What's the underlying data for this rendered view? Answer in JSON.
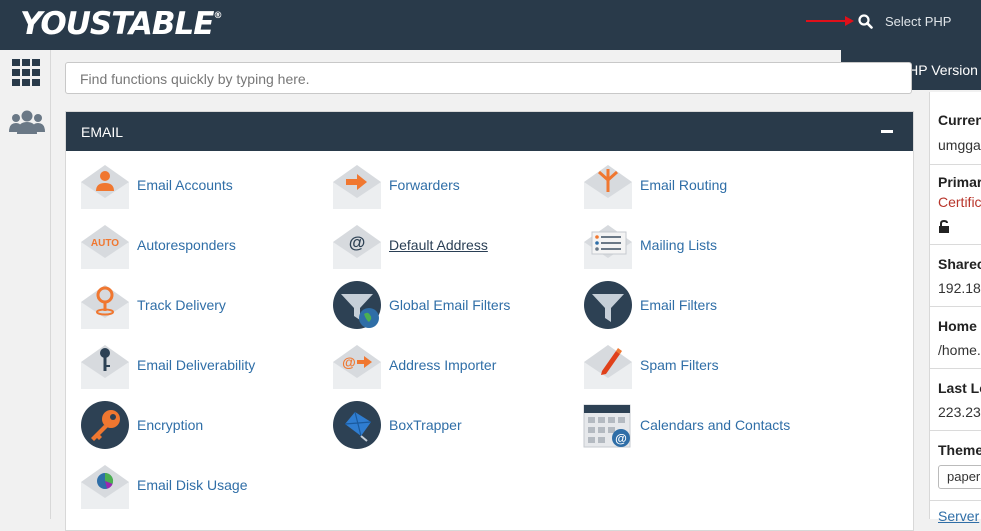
{
  "brand": {
    "name": "YOUSTABLE",
    "mark": "®"
  },
  "header": {
    "search_label": "Select PHP"
  },
  "dropdown": {
    "item": "Select PHP Version"
  },
  "search": {
    "placeholder": "Find functions quickly by typing here."
  },
  "email_panel": {
    "title": "EMAIL",
    "items": [
      {
        "label": "Email Accounts",
        "icon": "email-accounts-icon"
      },
      {
        "label": "Forwarders",
        "icon": "forwarders-icon"
      },
      {
        "label": "Email Routing",
        "icon": "email-routing-icon"
      },
      {
        "label": "Autoresponders",
        "icon": "autoresponders-icon",
        "badge": "AUTO"
      },
      {
        "label": "Default Address",
        "icon": "default-address-icon"
      },
      {
        "label": "Mailing Lists",
        "icon": "mailing-lists-icon"
      },
      {
        "label": "Track Delivery",
        "icon": "track-delivery-icon"
      },
      {
        "label": "Global Email Filters",
        "icon": "global-email-filters-icon"
      },
      {
        "label": "Email Filters",
        "icon": "email-filters-icon"
      },
      {
        "label": "Email Deliverability",
        "icon": "email-deliverability-icon"
      },
      {
        "label": "Address Importer",
        "icon": "address-importer-icon"
      },
      {
        "label": "Spam Filters",
        "icon": "spam-filters-icon"
      },
      {
        "label": "Encryption",
        "icon": "encryption-icon"
      },
      {
        "label": "BoxTrapper",
        "icon": "boxtrapper-icon"
      },
      {
        "label": "Calendars and Contacts",
        "icon": "calendars-contacts-icon"
      },
      {
        "label": "Email Disk Usage",
        "icon": "email-disk-usage-icon"
      }
    ]
  },
  "general_info": {
    "current_user_label": "Curren",
    "current_user_value": "umgga",
    "primary_domain_label": "Primar",
    "certificate_text": "Certific",
    "shared_ip_label": "Sharec",
    "shared_ip_value": "192.18",
    "home_dir_label": "Home",
    "home_dir_value": "/home.",
    "last_login_label": "Last Lo",
    "last_login_value": "223.23",
    "theme_label": "Theme",
    "theme_value": "paper",
    "server_link": "Server"
  },
  "colors": {
    "header_bg": "#293a4a",
    "link": "#2f6ea7",
    "accent_orange": "#f07730",
    "arrow_red": "#e0101a",
    "certificate_red": "#b8352b"
  }
}
